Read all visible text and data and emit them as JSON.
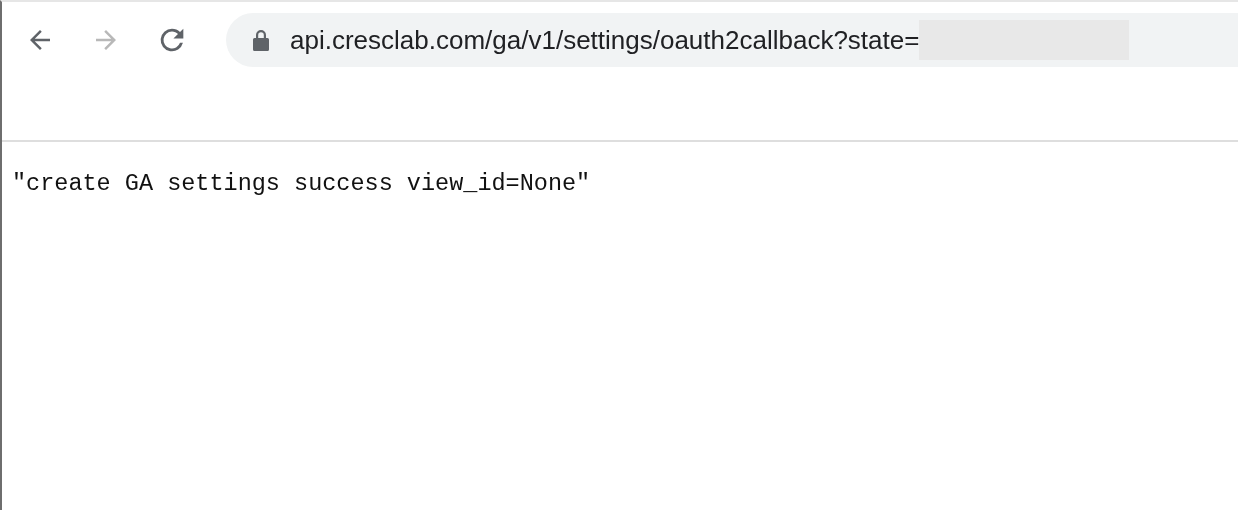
{
  "toolbar": {
    "back": {
      "disabled": false
    },
    "forward": {
      "disabled": true
    },
    "address": {
      "secure": true,
      "url": "api.cresclab.com/ga/v1/settings/oauth2callback?state=",
      "redacted": true
    }
  },
  "page": {
    "text": "\"create GA settings success view_id=None\""
  }
}
